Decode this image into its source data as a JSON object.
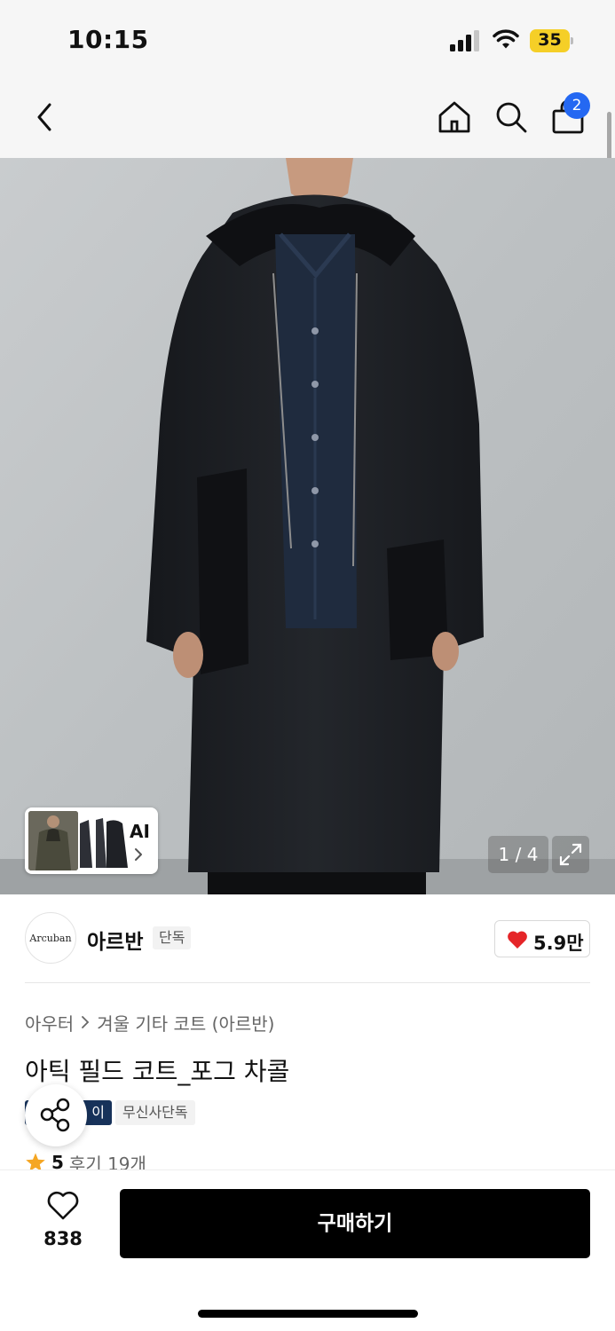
{
  "status_bar": {
    "time": "10:15",
    "battery_level": "35",
    "battery_color": "#f5cf27"
  },
  "nav": {
    "back_icon": "chevron-left-icon",
    "home_icon": "home-icon",
    "search_icon": "search-icon",
    "cart_icon": "shopping-bag-icon",
    "cart_badge": "2",
    "badge_color": "#2468f2"
  },
  "gallery": {
    "ai_label": "AI",
    "counter": "1 / 4",
    "expand_icon": "expand-icon"
  },
  "brand": {
    "logo_text": "Arcuban",
    "name": "아르반",
    "exclusive_tag": "단독",
    "like_count": "5.9만",
    "heart_color": "#e52528"
  },
  "breadcrumb": {
    "category": "아우터",
    "subcategory": "겨울 기타 코트 (아르반)"
  },
  "product": {
    "title": "아틱 필드 코트_포그 차콜",
    "tag_dark": "이",
    "tag_dark_color": "#17325a",
    "tag_light": "무신사단독",
    "rating": "5",
    "reviews": "후기 19개",
    "star_color": "#f5a623"
  },
  "actions": {
    "share_icon": "share-icon",
    "wish_icon": "heart-outline-icon",
    "wish_count": "838",
    "buy_label": "구매하기"
  }
}
